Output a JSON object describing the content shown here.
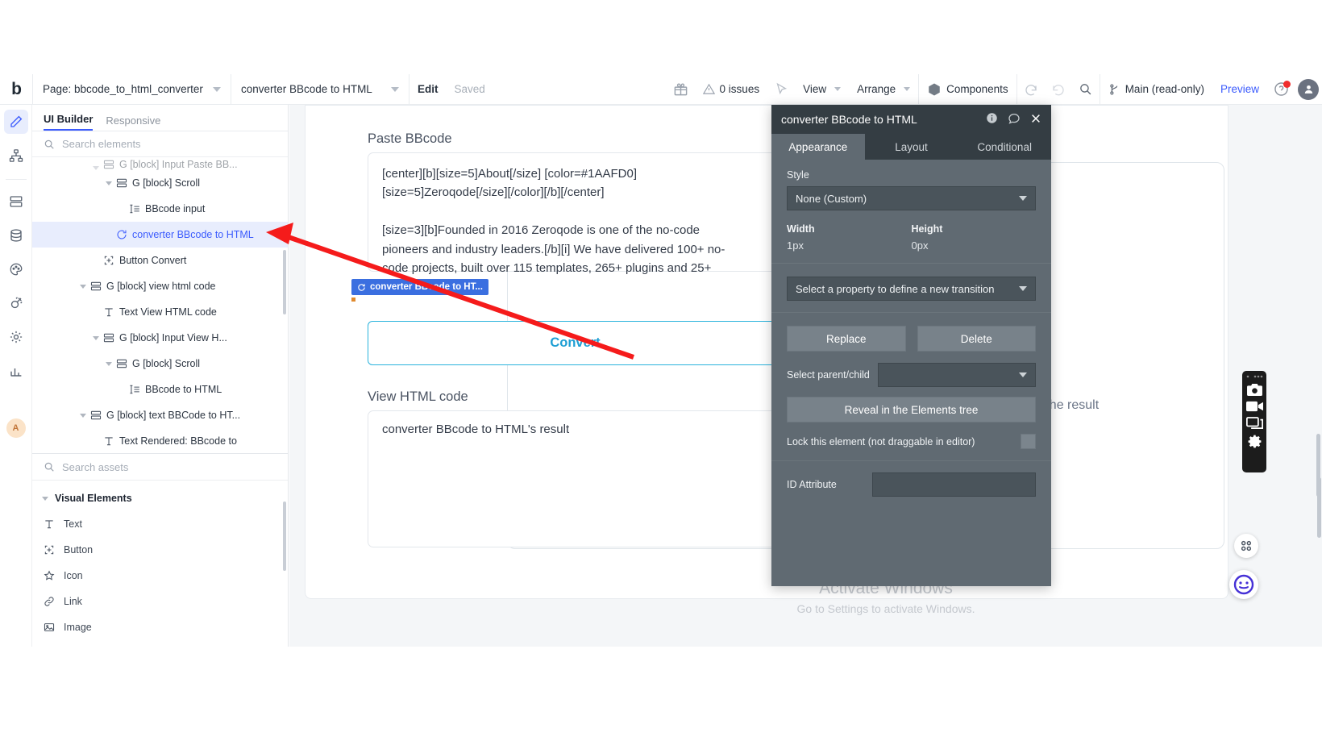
{
  "topbar": {
    "logo": "b",
    "page_select": "Page: bbcode_to_html_converter",
    "element_select": "converter BBcode to HTML",
    "edit_label": "Edit",
    "saved_label": "Saved",
    "gift_icon": "gift-icon",
    "issues_label": "0 issues",
    "cursor_icon": "cursor-icon",
    "view_label": "View",
    "arrange_label": "Arrange",
    "components_label": "Components",
    "undo_icon": "undo-icon",
    "redo_icon": "redo-icon",
    "search_icon": "search-icon",
    "branch_label": "Main (read-only)",
    "preview_label": "Preview",
    "help_icon": "help-icon",
    "account_icon": "account-icon"
  },
  "rail": {
    "items": [
      {
        "icon": "pencil-icon",
        "active": true
      },
      {
        "icon": "sitemap-icon",
        "active": false
      },
      {
        "icon": "layers-icon",
        "active": false
      },
      {
        "icon": "database-icon",
        "active": false
      },
      {
        "icon": "palette-icon",
        "active": false
      },
      {
        "icon": "plugin-icon",
        "active": false
      },
      {
        "icon": "gear-icon",
        "active": false
      },
      {
        "icon": "chart-icon",
        "active": false
      }
    ],
    "avatar_letter": "A"
  },
  "left_panel": {
    "tabs": [
      {
        "label": "UI Builder",
        "active": true
      },
      {
        "label": "Responsive",
        "active": false
      }
    ],
    "elements_search_placeholder": "Search elements",
    "assets_search_placeholder": "Search assets",
    "tree": [
      {
        "label": "G [block] Input Paste BB...",
        "indent": 4,
        "icon": "block-icon",
        "caret": true,
        "selected": false,
        "clipped": true
      },
      {
        "label": "G [block] Scroll",
        "indent": 5,
        "icon": "block-icon",
        "caret": true,
        "selected": false
      },
      {
        "label": "BBcode input",
        "indent": 6,
        "icon": "input-icon",
        "caret": false,
        "selected": false
      },
      {
        "label": "converter BBcode to HTML",
        "indent": 5,
        "icon": "api-icon",
        "caret": false,
        "selected": true
      },
      {
        "label": "Button Convert",
        "indent": 4,
        "icon": "button-icon",
        "caret": false,
        "selected": false
      },
      {
        "label": "G [block] view html code",
        "indent": 3,
        "icon": "block-icon",
        "caret": true,
        "selected": false
      },
      {
        "label": "Text View HTML code",
        "indent": 4,
        "icon": "text-icon",
        "caret": false,
        "selected": false
      },
      {
        "label": "G [block] Input View H...",
        "indent": 4,
        "icon": "block-icon",
        "caret": true,
        "selected": false
      },
      {
        "label": "G [block] Scroll",
        "indent": 5,
        "icon": "block-icon",
        "caret": true,
        "selected": false
      },
      {
        "label": "BBcode to HTML",
        "indent": 6,
        "icon": "input-icon",
        "caret": false,
        "selected": false
      },
      {
        "label": "G [block] text BBCode to HT...",
        "indent": 3,
        "icon": "block-icon",
        "caret": true,
        "selected": false
      },
      {
        "label": "Text Rendered: BBcode to",
        "indent": 4,
        "icon": "text-icon",
        "caret": false,
        "selected": false
      }
    ],
    "assets_group": "Visual Elements",
    "assets": [
      {
        "label": "Text",
        "icon": "text-icon"
      },
      {
        "label": "Button",
        "icon": "button-icon"
      },
      {
        "label": "Icon",
        "icon": "star-icon"
      },
      {
        "label": "Link",
        "icon": "link-icon"
      },
      {
        "label": "Image",
        "icon": "image-icon"
      }
    ]
  },
  "canvas": {
    "paste_label": "Paste BBcode",
    "bbcode_value": "[center][b][size=5]About[/size] [color=#1AAFD0]\n[size=5]Zeroqode[/size][/color][/b][/center]\n\n[size=3][b]Founded in 2016 Zeroqode is one of the no-code\npioneers and industry leaders.[/b][i] We have delivered 100+ no-\ncode projects, built over 115 templates, 265+ plugins and 25+",
    "convert_label": "Convert",
    "view_label": "View HTML code",
    "result_value": "converter BBcode to HTML's result",
    "occluded_text": "e the result",
    "element_tag": "converter BBcode to HT...",
    "element_tag_icon": "api-icon",
    "watermark_line1": "Activate Windows",
    "watermark_line2": "Go to Settings to activate Windows."
  },
  "property_panel": {
    "title": "converter BBcode to HTML",
    "head_icons": [
      "info-icon",
      "comment-icon",
      "close-icon"
    ],
    "tabs": [
      {
        "label": "Appearance",
        "active": true
      },
      {
        "label": "Layout",
        "active": false
      },
      {
        "label": "Conditional",
        "active": false
      }
    ],
    "style_label": "Style",
    "style_value": "None (Custom)",
    "width_label": "Width",
    "width_value": "1px",
    "height_label": "Height",
    "height_value": "0px",
    "transition_value": "Select a property to define a new transition",
    "replace_label": "Replace",
    "delete_label": "Delete",
    "select_parent_label": "Select parent/child",
    "select_parent_value": "",
    "reveal_label": "Reveal in the Elements tree",
    "lock_label": "Lock this element (not draggable in editor)",
    "id_attribute_label": "ID Attribute",
    "id_attribute_value": ""
  },
  "floating": {
    "recorder": [
      "camera-icon",
      "video-icon",
      "window-icon",
      "gear-icon"
    ],
    "grid_icon": "grid-icon",
    "circle_icon": "circle-widget-icon"
  },
  "annotation": {
    "arrow_color": "#f51b1b",
    "arrow_name": "red-pointer-arrow"
  }
}
